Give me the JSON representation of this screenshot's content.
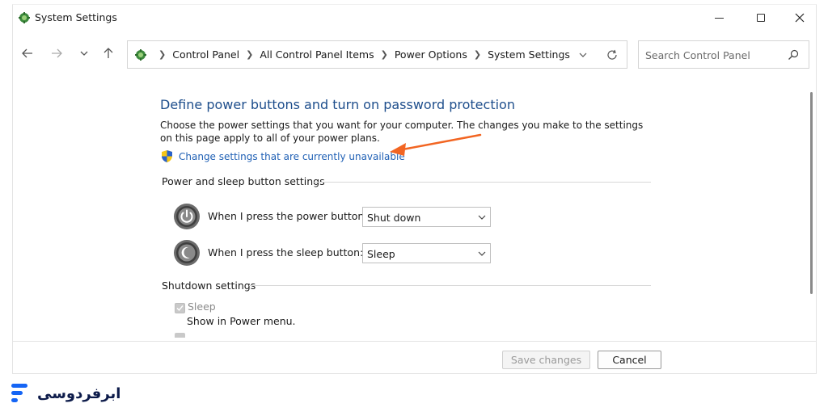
{
  "window": {
    "title": "System Settings"
  },
  "address": {
    "crumbs": [
      "Control Panel",
      "All Control Panel Items",
      "Power Options",
      "System Settings"
    ]
  },
  "search": {
    "placeholder": "Search Control Panel"
  },
  "content": {
    "title": "Define power buttons and turn on password protection",
    "description": "Choose the power settings that you want for your computer. The changes you make to the settings on this page apply to all of your power plans.",
    "change_link": "Change settings that are currently unavailable",
    "power_group": {
      "heading": "Power and sleep button settings",
      "rows": [
        {
          "label": "When I press the power button:",
          "value": "Shut down"
        },
        {
          "label": "When I press the sleep button:",
          "value": "Sleep"
        }
      ]
    },
    "shutdown_group": {
      "heading": "Shutdown settings",
      "items": [
        {
          "label": "Sleep",
          "sublabel": "Show in Power menu.",
          "checked": true
        }
      ]
    }
  },
  "footer": {
    "save_label": "Save changes",
    "cancel_label": "Cancel"
  },
  "logo": {
    "text": "ابرفردوسی"
  },
  "colors": {
    "title_blue": "#1e4e8c",
    "link_blue": "#1e5fb4",
    "annotation_arrow": "#f26522",
    "logo_blue": "#1565f5"
  },
  "icons": {
    "app": "control-panel-icon",
    "back": "arrow-left-icon",
    "forward": "arrow-right-icon",
    "recent": "chevron-down-icon",
    "up": "arrow-up-icon",
    "refresh": "refresh-icon",
    "search": "search-icon",
    "shield": "uac-shield-icon",
    "power": "power-icon",
    "sleep": "moon-icon"
  }
}
